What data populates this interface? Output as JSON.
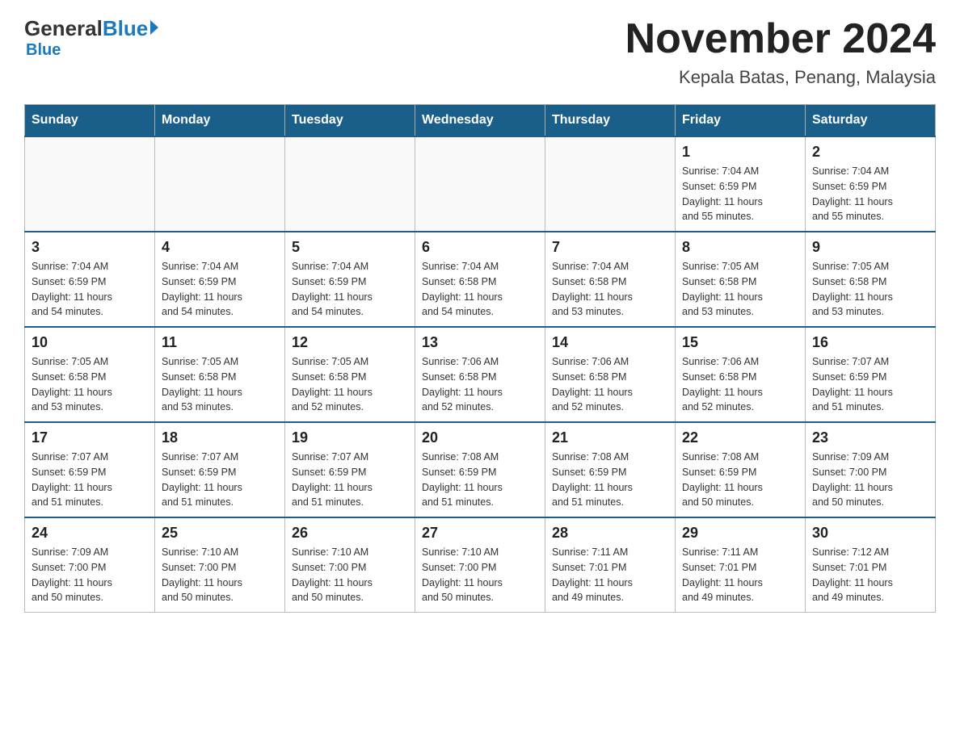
{
  "header": {
    "logo_text_general": "General",
    "logo_text_blue": "Blue",
    "main_title": "November 2024",
    "subtitle": "Kepala Batas, Penang, Malaysia"
  },
  "calendar": {
    "days_of_week": [
      "Sunday",
      "Monday",
      "Tuesday",
      "Wednesday",
      "Thursday",
      "Friday",
      "Saturday"
    ],
    "weeks": [
      [
        {
          "day": "",
          "info": ""
        },
        {
          "day": "",
          "info": ""
        },
        {
          "day": "",
          "info": ""
        },
        {
          "day": "",
          "info": ""
        },
        {
          "day": "",
          "info": ""
        },
        {
          "day": "1",
          "info": "Sunrise: 7:04 AM\nSunset: 6:59 PM\nDaylight: 11 hours\nand 55 minutes."
        },
        {
          "day": "2",
          "info": "Sunrise: 7:04 AM\nSunset: 6:59 PM\nDaylight: 11 hours\nand 55 minutes."
        }
      ],
      [
        {
          "day": "3",
          "info": "Sunrise: 7:04 AM\nSunset: 6:59 PM\nDaylight: 11 hours\nand 54 minutes."
        },
        {
          "day": "4",
          "info": "Sunrise: 7:04 AM\nSunset: 6:59 PM\nDaylight: 11 hours\nand 54 minutes."
        },
        {
          "day": "5",
          "info": "Sunrise: 7:04 AM\nSunset: 6:59 PM\nDaylight: 11 hours\nand 54 minutes."
        },
        {
          "day": "6",
          "info": "Sunrise: 7:04 AM\nSunset: 6:58 PM\nDaylight: 11 hours\nand 54 minutes."
        },
        {
          "day": "7",
          "info": "Sunrise: 7:04 AM\nSunset: 6:58 PM\nDaylight: 11 hours\nand 53 minutes."
        },
        {
          "day": "8",
          "info": "Sunrise: 7:05 AM\nSunset: 6:58 PM\nDaylight: 11 hours\nand 53 minutes."
        },
        {
          "day": "9",
          "info": "Sunrise: 7:05 AM\nSunset: 6:58 PM\nDaylight: 11 hours\nand 53 minutes."
        }
      ],
      [
        {
          "day": "10",
          "info": "Sunrise: 7:05 AM\nSunset: 6:58 PM\nDaylight: 11 hours\nand 53 minutes."
        },
        {
          "day": "11",
          "info": "Sunrise: 7:05 AM\nSunset: 6:58 PM\nDaylight: 11 hours\nand 53 minutes."
        },
        {
          "day": "12",
          "info": "Sunrise: 7:05 AM\nSunset: 6:58 PM\nDaylight: 11 hours\nand 52 minutes."
        },
        {
          "day": "13",
          "info": "Sunrise: 7:06 AM\nSunset: 6:58 PM\nDaylight: 11 hours\nand 52 minutes."
        },
        {
          "day": "14",
          "info": "Sunrise: 7:06 AM\nSunset: 6:58 PM\nDaylight: 11 hours\nand 52 minutes."
        },
        {
          "day": "15",
          "info": "Sunrise: 7:06 AM\nSunset: 6:58 PM\nDaylight: 11 hours\nand 52 minutes."
        },
        {
          "day": "16",
          "info": "Sunrise: 7:07 AM\nSunset: 6:59 PM\nDaylight: 11 hours\nand 51 minutes."
        }
      ],
      [
        {
          "day": "17",
          "info": "Sunrise: 7:07 AM\nSunset: 6:59 PM\nDaylight: 11 hours\nand 51 minutes."
        },
        {
          "day": "18",
          "info": "Sunrise: 7:07 AM\nSunset: 6:59 PM\nDaylight: 11 hours\nand 51 minutes."
        },
        {
          "day": "19",
          "info": "Sunrise: 7:07 AM\nSunset: 6:59 PM\nDaylight: 11 hours\nand 51 minutes."
        },
        {
          "day": "20",
          "info": "Sunrise: 7:08 AM\nSunset: 6:59 PM\nDaylight: 11 hours\nand 51 minutes."
        },
        {
          "day": "21",
          "info": "Sunrise: 7:08 AM\nSunset: 6:59 PM\nDaylight: 11 hours\nand 51 minutes."
        },
        {
          "day": "22",
          "info": "Sunrise: 7:08 AM\nSunset: 6:59 PM\nDaylight: 11 hours\nand 50 minutes."
        },
        {
          "day": "23",
          "info": "Sunrise: 7:09 AM\nSunset: 7:00 PM\nDaylight: 11 hours\nand 50 minutes."
        }
      ],
      [
        {
          "day": "24",
          "info": "Sunrise: 7:09 AM\nSunset: 7:00 PM\nDaylight: 11 hours\nand 50 minutes."
        },
        {
          "day": "25",
          "info": "Sunrise: 7:10 AM\nSunset: 7:00 PM\nDaylight: 11 hours\nand 50 minutes."
        },
        {
          "day": "26",
          "info": "Sunrise: 7:10 AM\nSunset: 7:00 PM\nDaylight: 11 hours\nand 50 minutes."
        },
        {
          "day": "27",
          "info": "Sunrise: 7:10 AM\nSunset: 7:00 PM\nDaylight: 11 hours\nand 50 minutes."
        },
        {
          "day": "28",
          "info": "Sunrise: 7:11 AM\nSunset: 7:01 PM\nDaylight: 11 hours\nand 49 minutes."
        },
        {
          "day": "29",
          "info": "Sunrise: 7:11 AM\nSunset: 7:01 PM\nDaylight: 11 hours\nand 49 minutes."
        },
        {
          "day": "30",
          "info": "Sunrise: 7:12 AM\nSunset: 7:01 PM\nDaylight: 11 hours\nand 49 minutes."
        }
      ]
    ]
  }
}
